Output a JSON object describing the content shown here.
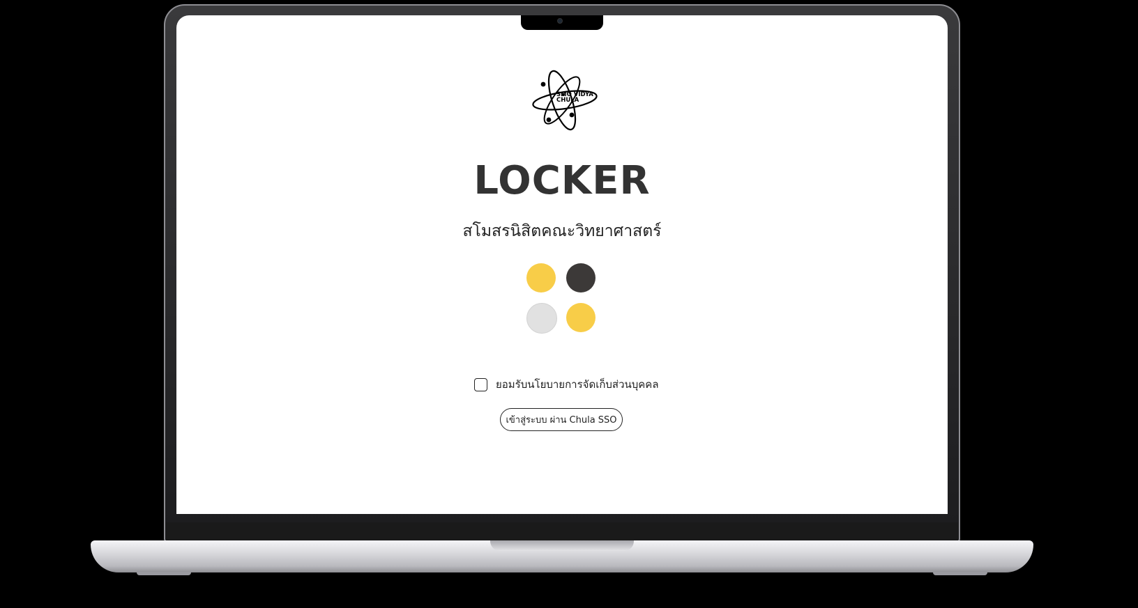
{
  "logo": {
    "line1": "SMO VIDYA",
    "line2": "CHULA"
  },
  "title": "LOCKER",
  "subtitle": "สโมสรนิสิตคณะวิทยาศาสตร์",
  "swatches": [
    {
      "color": "#F8CD48"
    },
    {
      "color": "#3C3938"
    },
    {
      "color": "#E1E1E1"
    },
    {
      "color": "#F8CD48"
    }
  ],
  "consent": {
    "label": "ยอมรับนโยบายการจัดเก็บส่วนบุคคล",
    "checked": false
  },
  "login_button": {
    "label": "เข้าสู่ระบบ ผ่าน Chula SSO"
  }
}
